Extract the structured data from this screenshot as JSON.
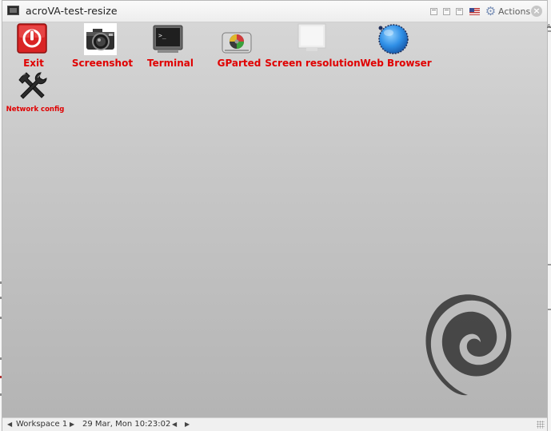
{
  "window": {
    "title": "acroVA-test-resize",
    "actions_label": "Actions",
    "icons": [
      "terminal-icon",
      "minimize-icon",
      "restore-icon",
      "maximize-icon",
      "us-flag-icon",
      "gear-icon",
      "close-icon"
    ]
  },
  "launchers": [
    {
      "label": "Exit",
      "icon": "power-icon",
      "color": "#e00000"
    },
    {
      "label": "Screenshot",
      "icon": "camera-icon",
      "color": "#e00000"
    },
    {
      "label": "Terminal",
      "icon": "terminal-icon",
      "color": "#e00000"
    },
    {
      "label": "GParted",
      "icon": "disk-icon",
      "color": "#e00000"
    },
    {
      "label": "Screen resolution",
      "icon": "monitor-icon",
      "color": "#e00000"
    },
    {
      "label": "Web Browser",
      "icon": "globe-icon",
      "color": "#e00000"
    },
    {
      "label": "Network config",
      "icon": "tools-icon",
      "color": "#e00000"
    }
  ],
  "desktop": {
    "logo_icon": "debian-swirl-icon"
  },
  "statusbar": {
    "workspace": "Workspace 1",
    "clock": "29 Mar, Mon 10:23:02"
  },
  "outside_text": {
    "right_edge": "AC"
  }
}
